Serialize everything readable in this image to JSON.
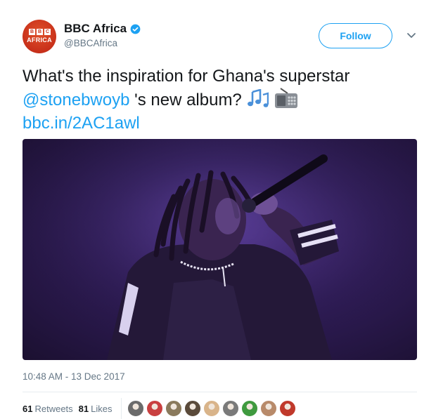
{
  "account": {
    "display_name": "BBC Africa",
    "handle": "@BBCAfrica",
    "avatar_letters": [
      "B",
      "B",
      "C"
    ],
    "avatar_text": "AFRICA",
    "verified": true
  },
  "actions": {
    "follow_label": "Follow",
    "menu_icon": "chevron-down-icon"
  },
  "tweet": {
    "text_before": "What's the inspiration for Ghana's superstar ",
    "mention": "@stonebwoyb",
    "text_after": " 's new album? ",
    "emojis": [
      "musical-notes-icon",
      "radio-icon"
    ],
    "link": "bbc.in/2AC1awl"
  },
  "media": {
    "type": "photo",
    "subject": "performer singing into microphone under purple stage light"
  },
  "timestamp": "10:48 AM - 13 Dec 2017",
  "stats": {
    "retweets_count": "61",
    "retweets_label": "Retweets",
    "likes_count": "81",
    "likes_label": "Likes"
  },
  "likers": [
    {
      "color": "#6b6b6b"
    },
    {
      "color": "#c94040"
    },
    {
      "color": "#8a7a5c"
    },
    {
      "color": "#5a4a3a"
    },
    {
      "color": "#d9b48a"
    },
    {
      "color": "#7a7a7a"
    },
    {
      "color": "#3f9a3f"
    },
    {
      "color": "#b88a6a"
    },
    {
      "color": "#c0392b"
    }
  ],
  "colors": {
    "accent": "#1da1f2",
    "text": "#14171a",
    "muted": "#657786",
    "avatar_bg": "#c8301a"
  }
}
